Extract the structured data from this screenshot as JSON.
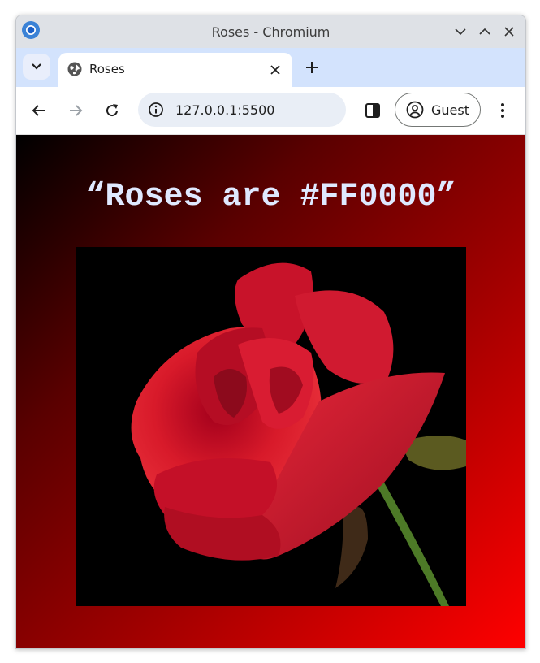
{
  "window": {
    "title": "Roses - Chromium"
  },
  "tabs": [
    {
      "title": "Roses"
    }
  ],
  "toolbar": {
    "url": "127.0.0.1:5500",
    "profile_label": "Guest"
  },
  "page": {
    "heading": "“Roses are #FF0000”",
    "image_alt": "Red rose on black background"
  },
  "colors": {
    "tabstrip": "#d3e3fd",
    "titlebar": "#dee1e6",
    "gradient_start": "#000000",
    "gradient_end": "#ff0000",
    "heading": "#dfe9ff"
  },
  "icons": [
    "chromium-logo-icon",
    "chevron-down-icon",
    "maximize-icon",
    "close-icon",
    "tab-search-icon",
    "globe-icon",
    "tab-close-icon",
    "new-tab-icon",
    "back-icon",
    "forward-icon",
    "reload-icon",
    "info-icon",
    "side-panel-icon",
    "profile-icon",
    "menu-icon"
  ]
}
